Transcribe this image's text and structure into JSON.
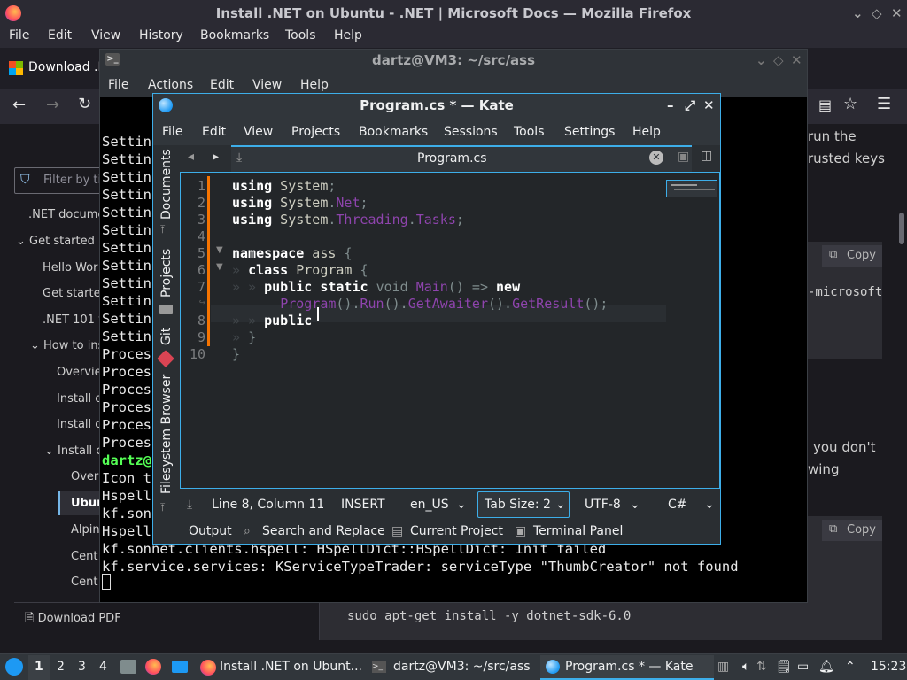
{
  "firefox": {
    "title": "Install .NET on Ubuntu - .NET | Microsoft Docs — Mozilla Firefox",
    "menu": [
      "File",
      "Edit",
      "View",
      "History",
      "Bookmarks",
      "Tools",
      "Help"
    ],
    "tab_label": "Download .N",
    "filter_placeholder": "Filter by ti",
    "toc": [
      ".NET docume",
      "Get started",
      "Hello Wor",
      "Get starte",
      ".NET 101 v",
      "How to ins",
      "Overvie",
      "Install c",
      "Install c",
      "Install c",
      "Over",
      "Ubun",
      "Alpin",
      "Cent",
      "Cent"
    ],
    "download_pdf": "Download PDF",
    "right_text": [
      "run the",
      "rusted keys",
      "-microsoft",
      "you don't",
      "wing"
    ],
    "copy": "Copy",
    "cmd": "sudo apt-get install -y dotnet-sdk-6.0"
  },
  "konsole": {
    "title": "dartz@VM3: ~/src/ass",
    "menu": [
      "File",
      "Actions",
      "Edit",
      "View",
      "Help"
    ],
    "lines": [
      "Settin",
      "Settin",
      "Settin",
      "Settin",
      "Settin",
      "Settin",
      "Settin",
      "Settin",
      "Settin",
      "Settin",
      "Settin",
      "Settin",
      "Proces",
      "Proces",
      "Proces",
      "Proces",
      "Proces",
      "Proces",
      "dartz@",
      "Icon t",
      "Hspell",
      "kf.son",
      "Hspell",
      "kf.sonnet.clients.hspell: HSpellDict::HSpellDict: Init failed",
      "kf.service.services: KServiceTypeTrader: serviceType \"ThumbCreator\" not found"
    ]
  },
  "kate": {
    "title": "Program.cs * — Kate",
    "menu": [
      "File",
      "Edit",
      "View",
      "Projects",
      "Bookmarks",
      "Sessions",
      "Tools",
      "Settings",
      "Help"
    ],
    "tab": "Program.cs",
    "side": [
      "Documents",
      "Projects",
      "Git",
      "Filesystem Browser"
    ],
    "line_numbers": [
      "1",
      "2",
      "3",
      "4",
      "5",
      "6",
      "7",
      "",
      "8",
      "9",
      "10"
    ],
    "status": {
      "position": "Line 8, Column 11",
      "mode": "INSERT",
      "lang": "en_US",
      "tabsize": "Tab Size: 2",
      "encoding": "UTF-8",
      "syntax": "C#"
    },
    "bottom": {
      "output": "Output",
      "search": "Search and Replace",
      "project": "Current Project",
      "terminal": "Terminal Panel"
    }
  },
  "taskbar": {
    "desktops": [
      "1",
      "2",
      "3",
      "4"
    ],
    "tasks": [
      "Install .NET on Ubunt...",
      "dartz@VM3: ~/src/ass",
      "Program.cs * — Kate"
    ],
    "clock": "15:23"
  }
}
